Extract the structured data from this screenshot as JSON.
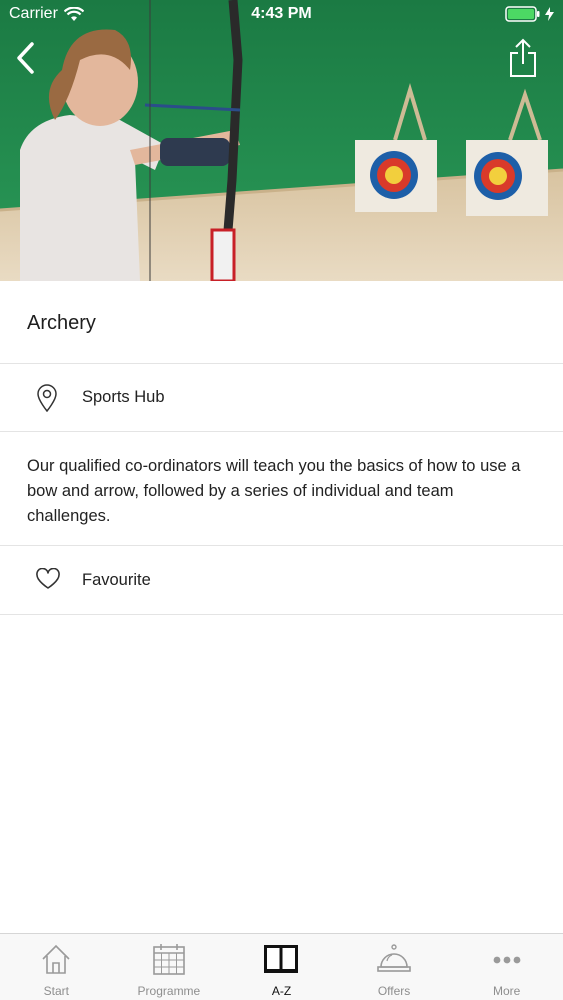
{
  "status_bar": {
    "carrier": "Carrier",
    "time": "4:43 PM"
  },
  "header": {
    "back_icon": "chevron-left-icon",
    "share_icon": "share-icon"
  },
  "activity": {
    "title": "Archery",
    "location_icon": "map-pin-icon",
    "location": "Sports Hub",
    "description": "Our qualified co-ordinators will teach you the basics of how to use a bow and arrow, followed by a series of individual and team challenges.",
    "favourite_icon": "heart-icon",
    "favourite_label": "Favourite"
  },
  "tab_bar": {
    "active": "A-Z",
    "tabs": [
      {
        "label": "Start",
        "icon": "home-icon"
      },
      {
        "label": "Programme",
        "icon": "calendar-icon"
      },
      {
        "label": "A-Z",
        "icon": "book-icon"
      },
      {
        "label": "Offers",
        "icon": "service-bell-icon"
      },
      {
        "label": "More",
        "icon": "more-dots-icon"
      }
    ]
  },
  "colors": {
    "hero_background": "#1f8a4e",
    "battery": "#4cd964",
    "divider": "#e4e4e4",
    "tab_inactive": "#8e8e8e",
    "tab_active": "#111111"
  }
}
